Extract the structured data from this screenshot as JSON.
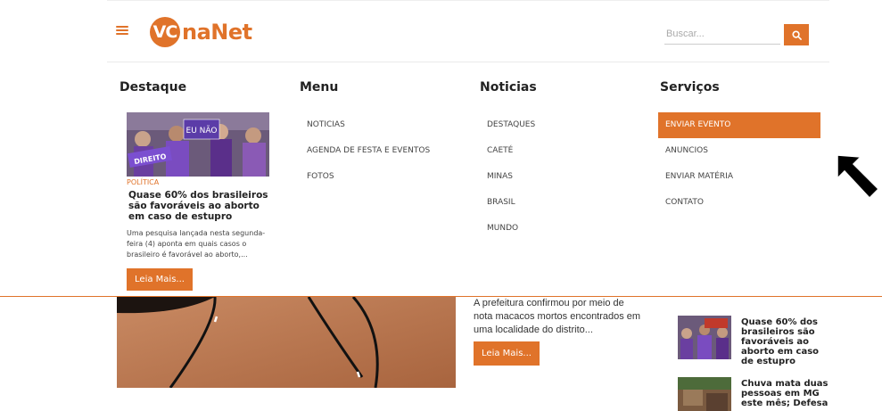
{
  "header": {
    "logo_circle": "VC",
    "logo_text": "naNet",
    "search_placeholder": "Buscar..."
  },
  "mega_menu": {
    "destaque": {
      "title": "Destaque",
      "image_banner": "EU NÃO",
      "image_sign": "DIREITO",
      "category": "POLÍTICA",
      "headline": "Quase 60% dos brasileiros são favoráveis ao aborto em caso de estupro",
      "excerpt": "Uma pesquisa lançada nesta segunda-feira (4) aponta em quais casos o brasileiro é favorável ao aborto,...",
      "button": "Leia Mais..."
    },
    "menu": {
      "title": "Menu",
      "items": [
        "NOTICIAS",
        "AGENDA DE FESTA E EVENTOS",
        "FOTOS"
      ]
    },
    "noticias": {
      "title": "Noticias",
      "items": [
        "DESTAQUES",
        "CAETÉ",
        "MINAS",
        "BRASIL",
        "MUNDO"
      ]
    },
    "servicos": {
      "title": "Serviços",
      "items": [
        "ENVIAR EVENTO",
        "ANUNCIOS",
        "ENVIAR MATÉRIA",
        "CONTATO"
      ],
      "active_index": 0
    }
  },
  "content": {
    "mid_text": "A prefeitura confirmou por meio de nota macacos mortos encontrados em uma localidade do distrito...",
    "mid_button": "Leia Mais...",
    "sidebar": [
      {
        "title": "Quase 60% dos brasileiros são favoráveis ao aborto em caso de estupro"
      },
      {
        "title": "Chuva mata duas pessoas em MG este mês; Defesa"
      }
    ]
  },
  "colors": {
    "accent": "#e0732a",
    "text_dark": "#222222"
  }
}
